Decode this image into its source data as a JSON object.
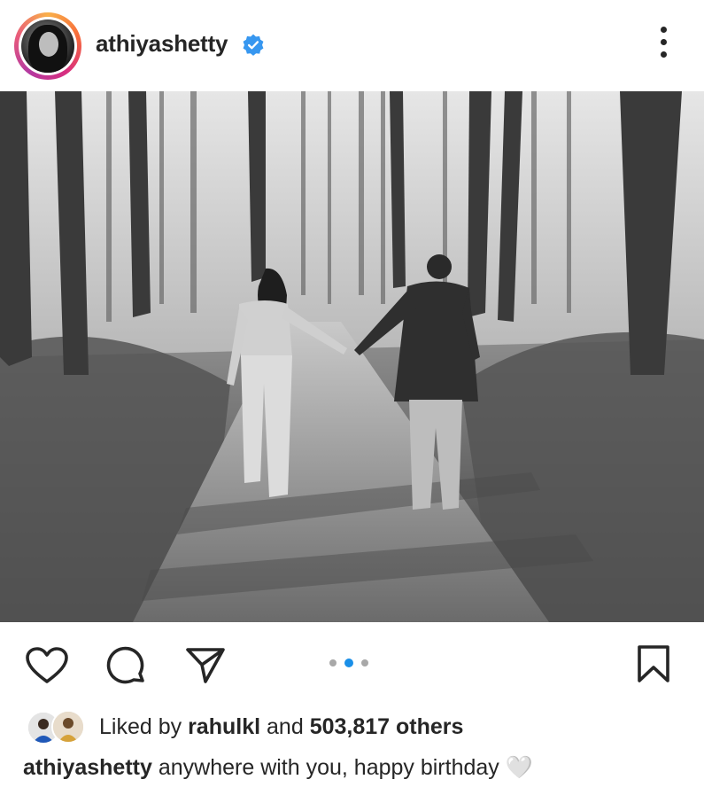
{
  "post": {
    "username": "athiyashetty",
    "verified": true,
    "carousel": {
      "count": 3,
      "active_index": 1
    }
  },
  "likes": {
    "prefix": "Liked by",
    "user": "rahulkl",
    "joiner": "and",
    "count_text": "503,817 others"
  },
  "caption": {
    "username": "athiyashetty",
    "text": "anywhere with you, happy birthday",
    "emoji": "🤍"
  },
  "icons": {
    "avatar": "profile-avatar",
    "verified": "verified-badge-icon",
    "more": "more-options-icon",
    "like": "heart-icon",
    "comment": "comment-icon",
    "share": "paper-plane-icon",
    "save": "bookmark-icon"
  },
  "colors": {
    "text": "#262626",
    "verified": "#3797f0",
    "active_dot": "#1a8fe8",
    "inactive_dot": "#a8a8a8"
  }
}
